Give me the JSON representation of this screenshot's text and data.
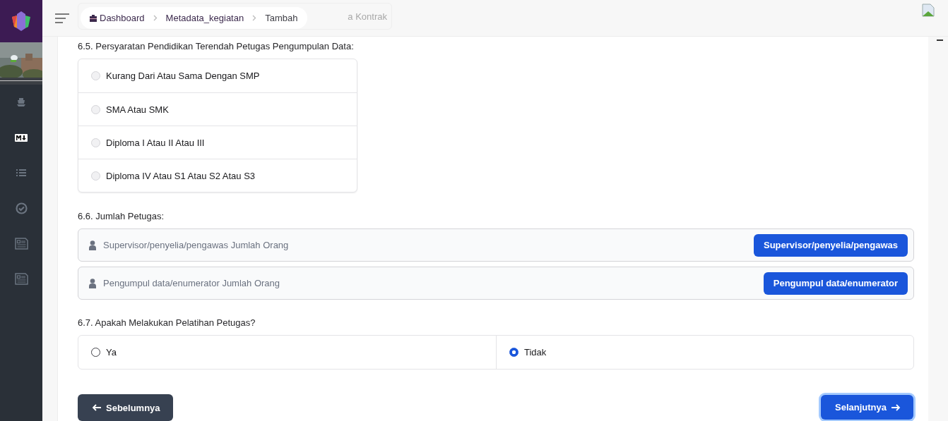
{
  "header": {
    "behind_text": "a Kontrak",
    "breadcrumb": [
      {
        "label": "Dashboard",
        "kind": "home"
      },
      {
        "label": "Metadata_kegiatan",
        "kind": "link"
      },
      {
        "label": "Tambah",
        "kind": "current"
      }
    ]
  },
  "sections": [
    {
      "kind": "radio_list",
      "title": "6.5. Persyaratan Pendidikan Terendah Petugas Pengumpulan Data:",
      "options": [
        {
          "label": "Kurang Dari Atau Sama Dengan SMP",
          "selected": false
        },
        {
          "label": "SMA Atau SMK",
          "selected": false
        },
        {
          "label": "Diploma I Atau II Atau III",
          "selected": false
        },
        {
          "label": "Diploma IV Atau S1 Atau S2 Atau S3",
          "selected": false
        }
      ]
    },
    {
      "kind": "counts",
      "title": "6.6. Jumlah Petugas:",
      "fields": [
        {
          "placeholder": "Supervisor/penyelia/pengawas Jumlah Orang",
          "button": "Supervisor/penyelia/pengawas"
        },
        {
          "placeholder": "Pengumpul data/enumerator Jumlah Orang",
          "button": "Pengumpul data/enumerator"
        }
      ]
    },
    {
      "kind": "radio_row",
      "title": "6.7. Apakah Melakukan Pelatihan Petugas?",
      "options": [
        {
          "label": "Ya",
          "selected": false
        },
        {
          "label": "Tidak",
          "selected": true
        }
      ]
    }
  ],
  "nav": {
    "previous": "Sebelumnya",
    "next": "Selanjutnya"
  }
}
